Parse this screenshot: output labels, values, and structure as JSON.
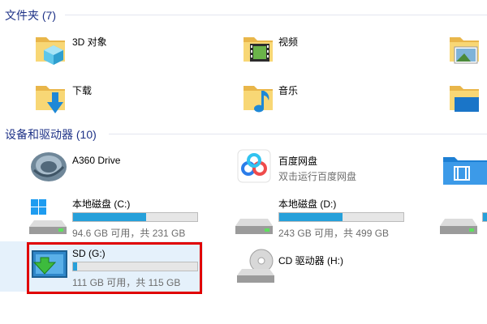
{
  "folders": {
    "header": "文件夹 (7)",
    "items": [
      {
        "label": "3D 对象",
        "icon": "3d-objects-folder-icon"
      },
      {
        "label": "视频",
        "icon": "videos-folder-icon"
      },
      {
        "label": "",
        "icon": "pictures-folder-icon"
      },
      {
        "label": "下载",
        "icon": "downloads-folder-icon"
      },
      {
        "label": "音乐",
        "icon": "music-folder-icon"
      },
      {
        "label": "",
        "icon": "desktop-folder-icon"
      }
    ]
  },
  "devices": {
    "header": "设备和驱动器 (10)",
    "items": [
      {
        "label": "A360 Drive",
        "icon": "a360-drive-icon"
      },
      {
        "label": "百度网盘",
        "sub": "双击运行百度网盘",
        "icon": "baidu-netdisk-icon"
      },
      {
        "label": "",
        "icon": "media-folder-icon"
      },
      {
        "label": "本地磁盘 (C:)",
        "sub": "94.6 GB 可用，共 231 GB",
        "usage": 0.59,
        "icon": "windows-drive-icon"
      },
      {
        "label": "本地磁盘 (D:)",
        "sub": "243 GB 可用，共 499 GB",
        "usage": 0.51,
        "icon": "hard-drive-icon"
      },
      {
        "label": "",
        "icon": "hard-drive-icon"
      },
      {
        "label": "SD (G:)",
        "sub": "111 GB 可用，共 115 GB",
        "usage": 0.03,
        "icon": "sd-card-drive-icon"
      },
      {
        "label": "CD 驱动器 (H:)",
        "icon": "cd-drive-icon"
      }
    ]
  },
  "colors": {
    "header": "#1e3287",
    "bar_fill": "#26a0da",
    "selection": "#e5f1fb",
    "highlight": "#e00000"
  }
}
